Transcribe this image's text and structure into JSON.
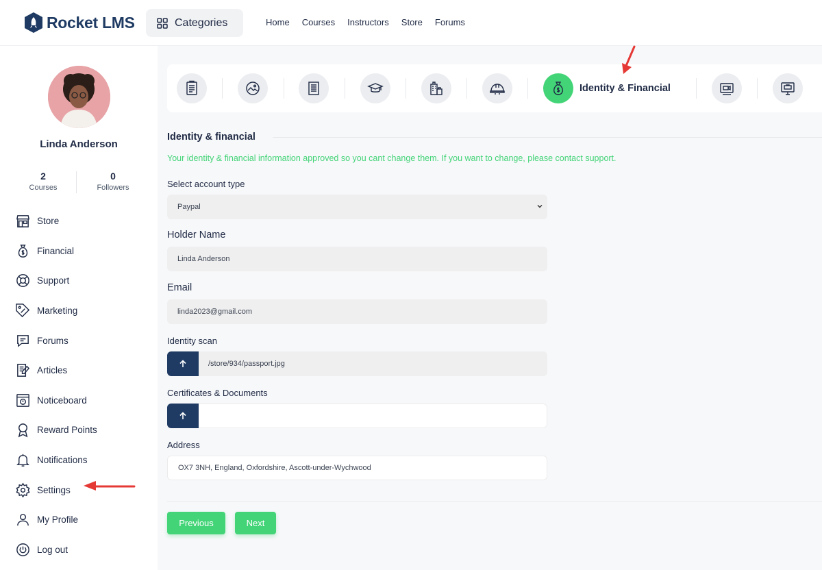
{
  "header": {
    "logo_text": "Rocket LMS",
    "categories_label": "Categories",
    "nav": [
      "Home",
      "Courses",
      "Instructors",
      "Store",
      "Forums"
    ]
  },
  "sidebar": {
    "user_name": "Linda Anderson",
    "stats": [
      {
        "value": "2",
        "label": "Courses"
      },
      {
        "value": "0",
        "label": "Followers"
      }
    ],
    "menu": [
      {
        "label": "Store",
        "icon": "store-icon"
      },
      {
        "label": "Financial",
        "icon": "money-bag-icon"
      },
      {
        "label": "Support",
        "icon": "lifebuoy-icon"
      },
      {
        "label": "Marketing",
        "icon": "tag-icon"
      },
      {
        "label": "Forums",
        "icon": "chat-icon"
      },
      {
        "label": "Articles",
        "icon": "article-icon"
      },
      {
        "label": "Noticeboard",
        "icon": "noticeboard-icon"
      },
      {
        "label": "Reward Points",
        "icon": "award-icon"
      },
      {
        "label": "Notifications",
        "icon": "bell-icon"
      },
      {
        "label": "Settings",
        "icon": "gear-icon"
      },
      {
        "label": "My Profile",
        "icon": "user-icon"
      },
      {
        "label": "Log out",
        "icon": "power-icon"
      }
    ]
  },
  "steps": {
    "active_label": "Identity & Financial",
    "icons": [
      "document-icon",
      "image-icon",
      "list-icon",
      "graduation-cap-icon",
      "building-icon",
      "helmet-icon",
      "money-bag-icon",
      "video-icon",
      "presentation-icon"
    ]
  },
  "form": {
    "section_title": "Identity & financial",
    "notice": "Your identity & financial information approved so you cant change them. If you want to change, please contact support.",
    "account_type_label": "Select account type",
    "account_type_value": "Paypal",
    "holder_name_label": "Holder Name",
    "holder_name_value": "Linda Anderson",
    "email_label": "Email",
    "email_value": "linda2023@gmail.com",
    "identity_scan_label": "Identity scan",
    "identity_scan_value": "/store/934/passport.jpg",
    "certificates_label": "Certificates & Documents",
    "certificates_value": "",
    "address_label": "Address",
    "address_value": "OX7 3NH, England, Oxfordshire, Ascott-under-Wychwood",
    "previous_label": "Previous",
    "next_label": "Next"
  },
  "colors": {
    "primary": "#43d477",
    "navy": "#1f3b63",
    "annotation": "#e53935"
  }
}
